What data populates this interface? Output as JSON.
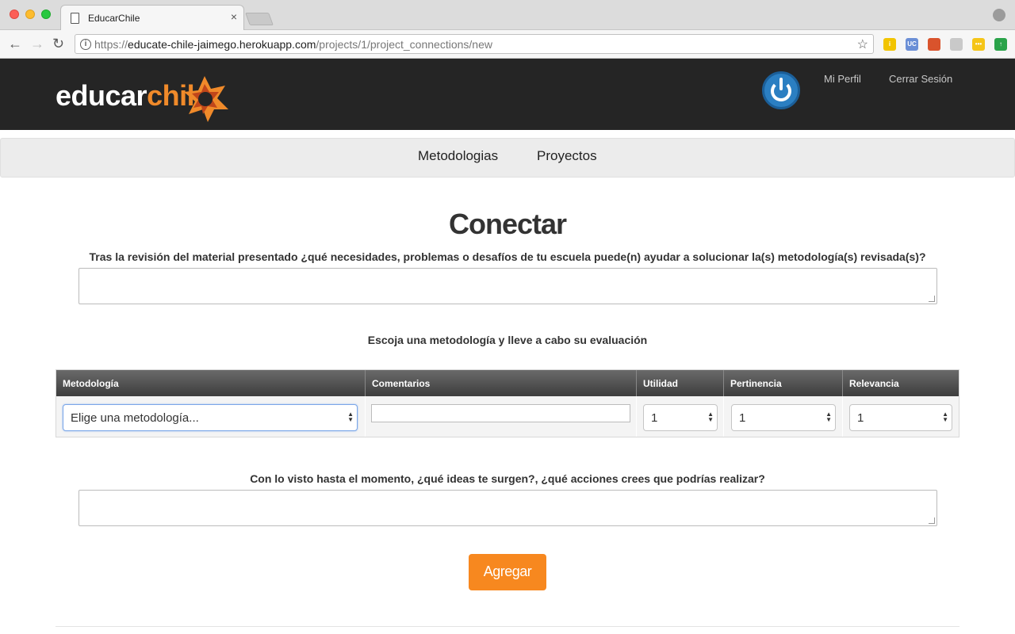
{
  "browser": {
    "tab_title": "EducarChile",
    "tab_close": "×",
    "url_scheme": "https://",
    "url_host": "educate-chile-jaimego.herokuapp.com",
    "url_path": "/projects/1/project_connections/new",
    "back_glyph": "←",
    "forward_glyph": "→",
    "reload_glyph": "↻",
    "info_glyph": "i",
    "star_glyph": "☆",
    "extensions": [
      {
        "name": "info-extension-icon",
        "label": "i",
        "color": "#f2c400"
      },
      {
        "name": "uc-extension-icon",
        "label": "UC",
        "color": "#6b8fd6"
      },
      {
        "name": "color-extension-icon",
        "label": "",
        "color": "#d9532c"
      },
      {
        "name": "shield-extension-icon",
        "label": "",
        "color": "#c9c9c9"
      },
      {
        "name": "dots-extension-icon",
        "label": "•••",
        "color": "#f5c518"
      },
      {
        "name": "upload-extension-icon",
        "label": "↑",
        "color": "#2aa34a"
      }
    ]
  },
  "header": {
    "logo_main": "educar",
    "logo_accent": "chil",
    "logo_end": "e",
    "links": [
      "Mi Perfil",
      "Cerrar Sesión"
    ]
  },
  "nav": {
    "items": [
      "Metodologias",
      "Proyectos"
    ]
  },
  "main": {
    "title": "Conectar",
    "question1": "Tras la revisión del material presentado ¿qué necesidades, problemas o desafíos de tu escuela puede(n) ayudar a solucionar la(s) metodología(s) revisada(s)?",
    "section_label": "Escoja una metodología y lleve a cabo su evaluación",
    "table": {
      "headers": [
        "Metodología",
        "Comentarios",
        "Utilidad",
        "Pertinencia",
        "Relevancia"
      ],
      "row": {
        "metodologia": "Elige una metodología...",
        "comentarios": "",
        "utilidad": "1",
        "pertinencia": "1",
        "relevancia": "1"
      }
    },
    "question2": "Con lo visto hasta el momento, ¿qué ideas te surgen?, ¿qué acciones crees que podrías realizar?",
    "submit_label": "Agregar"
  },
  "colors": {
    "accent": "#f7881f",
    "header_bg": "#252525",
    "navbar_bg": "#ececec",
    "power_blue": "#2b7fc2"
  }
}
